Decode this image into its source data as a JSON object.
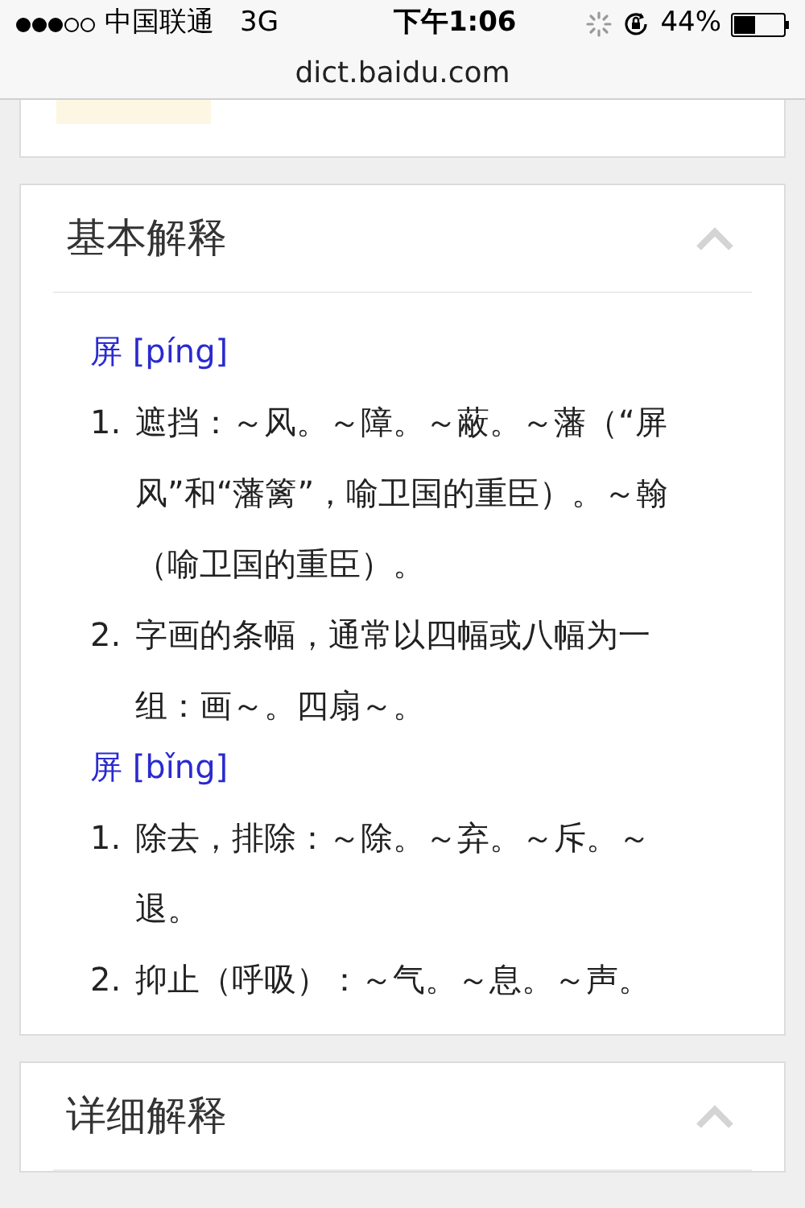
{
  "status_bar": {
    "signal_dots": [
      {
        "filled": true
      },
      {
        "filled": true
      },
      {
        "filled": true
      },
      {
        "filled": false
      },
      {
        "filled": false
      }
    ],
    "carrier": "中国联通",
    "network": "3G",
    "time": "下午1:06",
    "battery_percent": "44%",
    "battery": {
      "level": 0.44
    }
  },
  "address_bar": {
    "url": "dict.baidu.com"
  },
  "sections": [
    {
      "title": "基本解释",
      "expanded": true,
      "readings": [
        {
          "heading": "屏 [píng]",
          "items": [
            {
              "number": "1.",
              "text": "遮挡：～风。～障。～蔽。～藩（“屏风”和“藩篱”，喻卫国的重臣）。～翰（喻卫国的重臣）。"
            },
            {
              "number": "2.",
              "text": "字画的条幅，通常以四幅或八幅为一组：画～。四扇～。"
            }
          ]
        },
        {
          "heading": "屏 [bǐng]",
          "items": [
            {
              "number": "1.",
              "text": "除去，排除：～除。～弃。～斥。～退。"
            },
            {
              "number": "2.",
              "text": "抑止（呼吸）：～气。～息。～声。"
            }
          ]
        }
      ]
    },
    {
      "title": "详细解释",
      "expanded": true
    }
  ]
}
